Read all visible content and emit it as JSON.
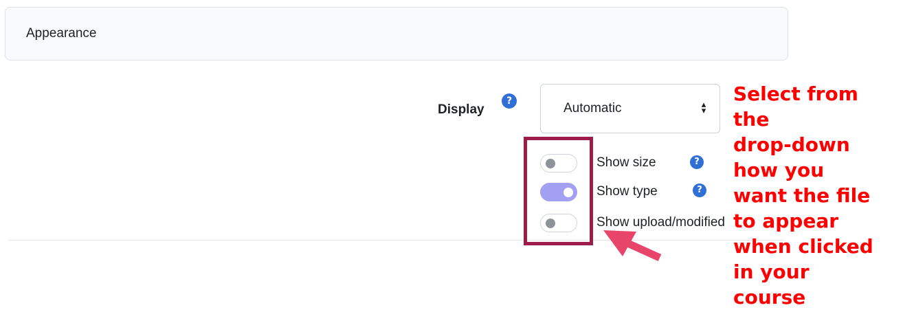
{
  "section": {
    "title": "Appearance"
  },
  "display": {
    "label": "Display",
    "help_icon": "question-circle-icon",
    "select_value": "Automatic",
    "select_arrow_icon": "sort-arrows-icon"
  },
  "options": [
    {
      "label": "Show size",
      "enabled": false,
      "help_icon": "question-circle-icon"
    },
    {
      "label": "Show type",
      "enabled": true,
      "help_icon": "question-circle-icon"
    },
    {
      "label": "Show upload/modified",
      "enabled": false
    }
  ],
  "help_glyph": "?",
  "annotation": {
    "lines": [
      "Select from",
      "the",
      "drop-down",
      "how you",
      "want the file",
      "to appear",
      "when clicked",
      "in your",
      "course"
    ]
  },
  "colors": {
    "annotation_text": "#ff0000",
    "highlight_box": "#9c1c4a",
    "arrow": "#e8456b",
    "toggle_on": "#a3a0f2",
    "help_icon": "#2f6fd6"
  }
}
